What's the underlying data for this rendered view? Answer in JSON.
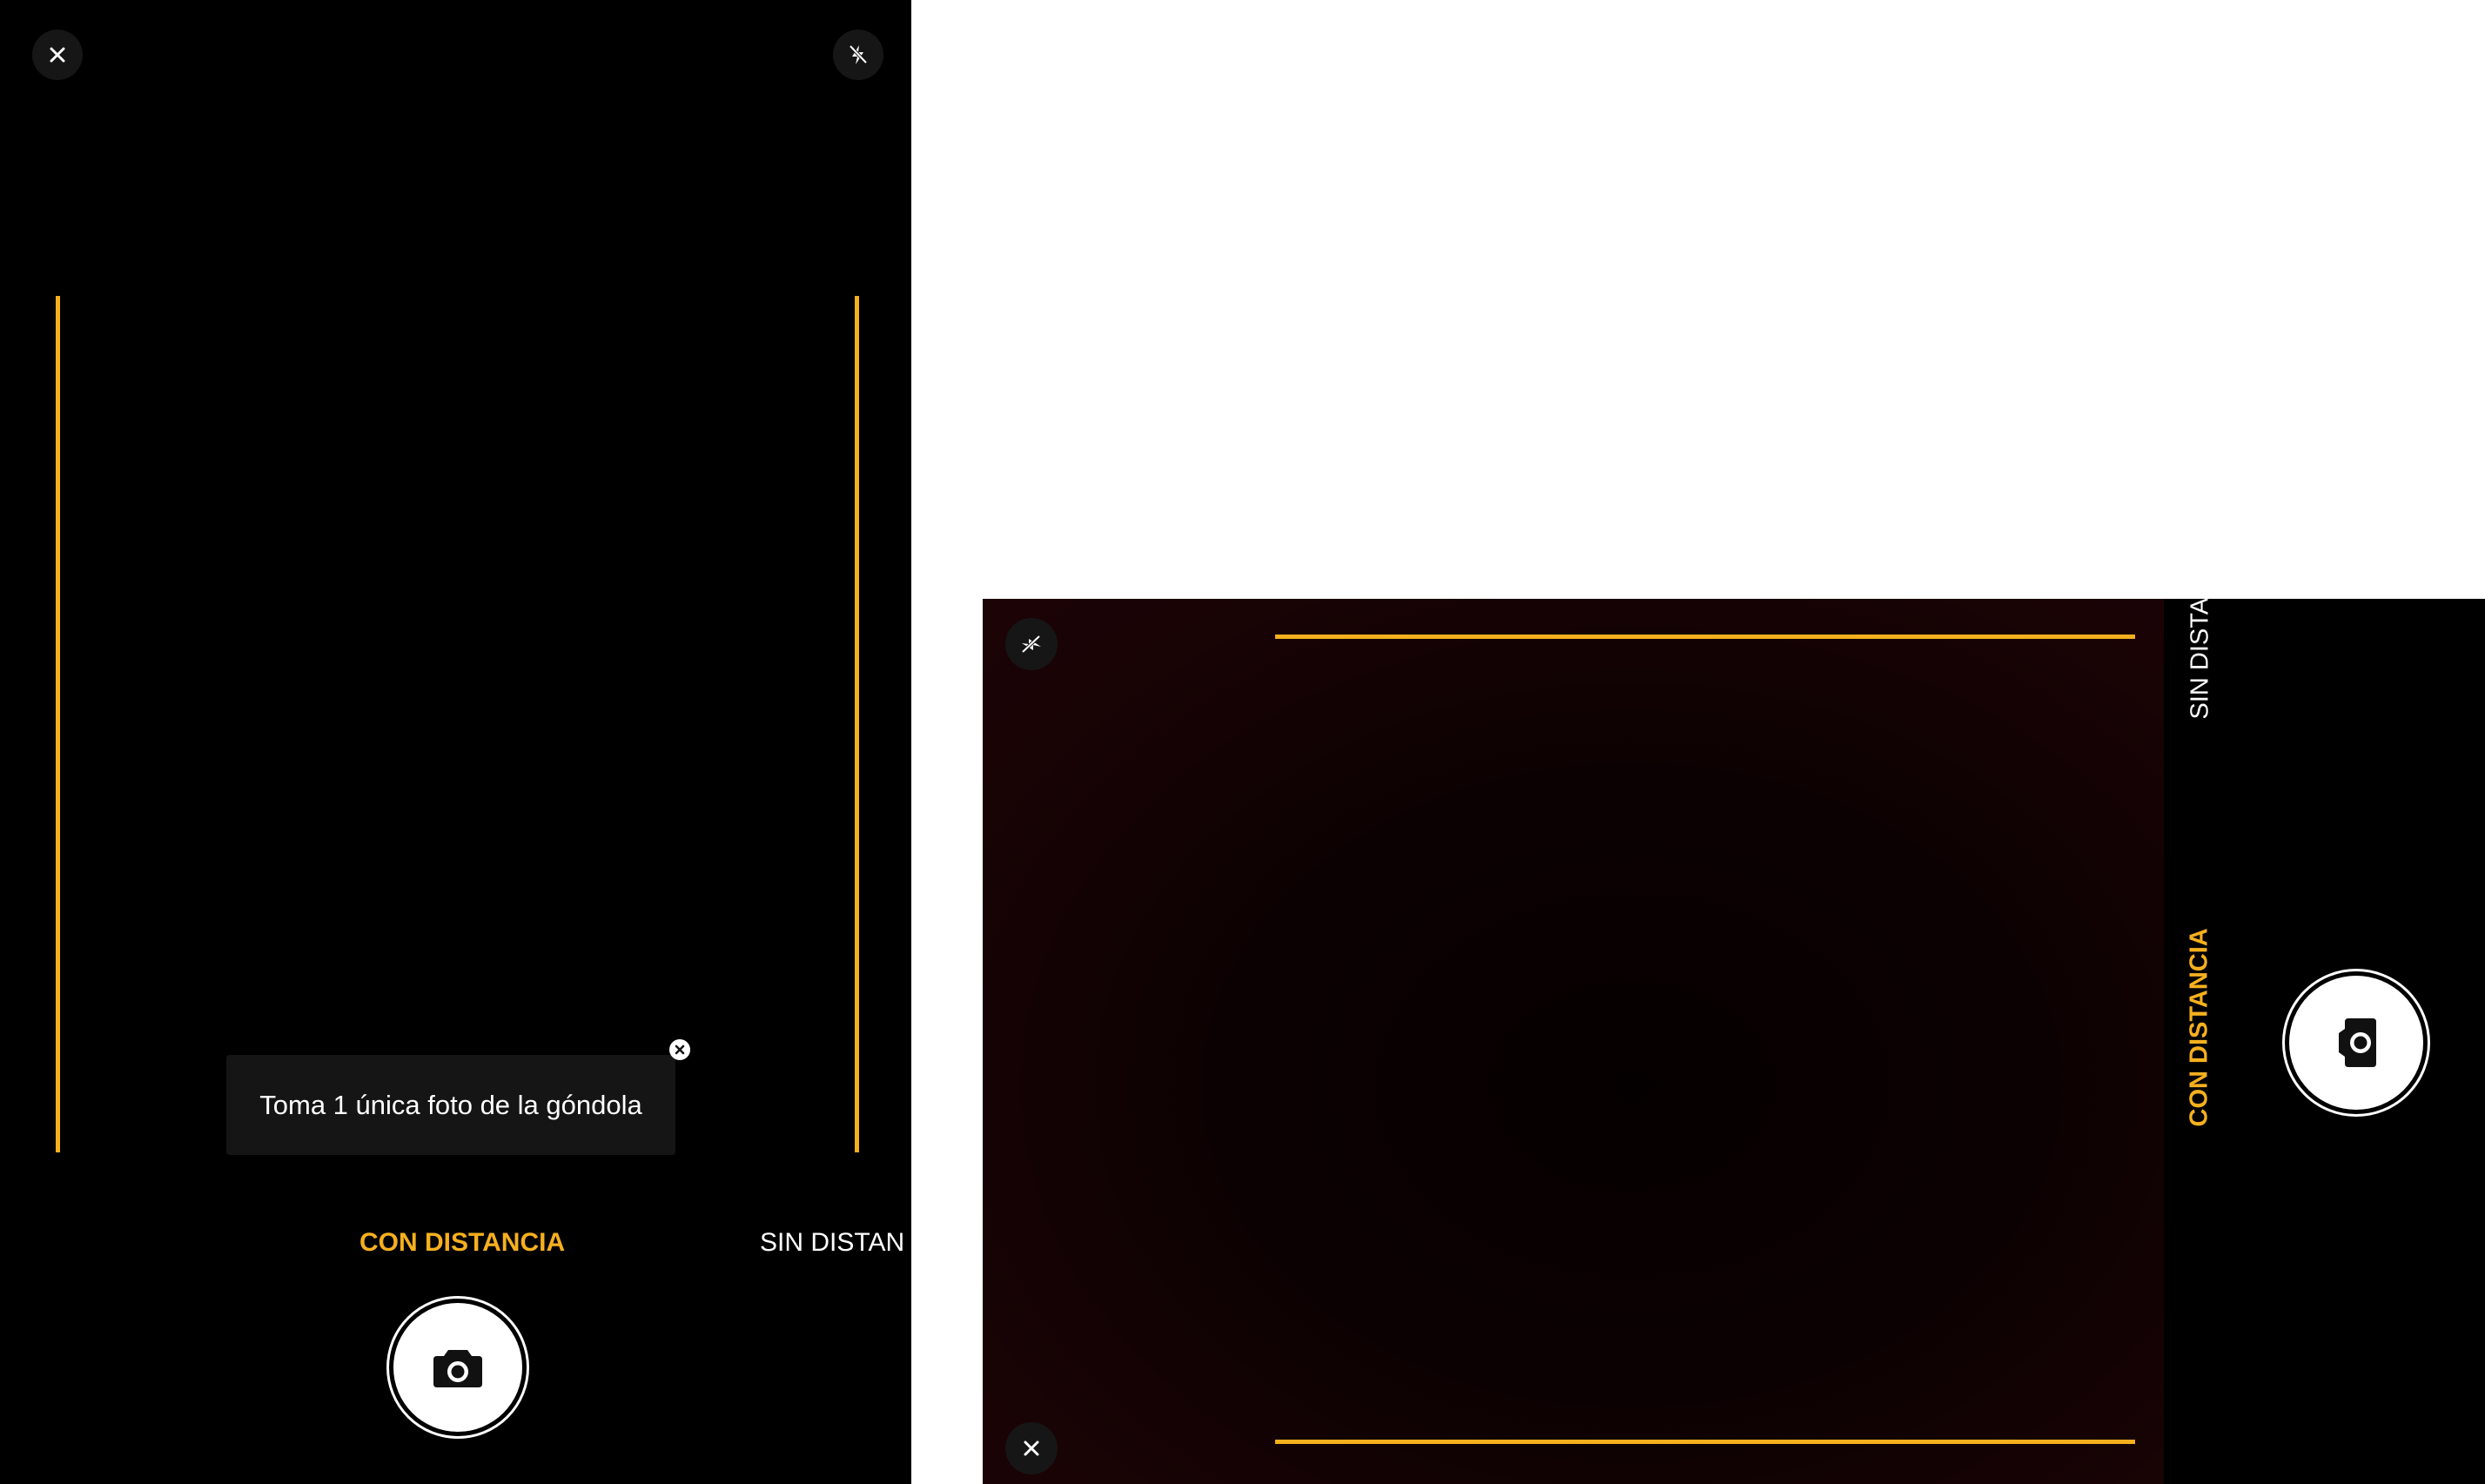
{
  "portrait": {
    "tooltip_text": "Toma 1 única foto de la góndola",
    "modes": {
      "active": "CON DISTANCIA",
      "inactive": "SIN DISTAN"
    },
    "icons": {
      "close": "close-icon",
      "flash_off": "flash-off-icon",
      "shutter": "camera-icon",
      "tooltip_close": "close-circle-icon"
    }
  },
  "landscape": {
    "modes": {
      "active": "CON DISTANCIA",
      "inactive": "SIN DISTAN"
    },
    "icons": {
      "close": "close-icon",
      "flash_off": "flash-off-icon",
      "shutter": "camera-icon"
    }
  },
  "colors": {
    "accent": "#f6b01e",
    "background": "#000000",
    "viewfinder_tint": "#1c0306"
  }
}
